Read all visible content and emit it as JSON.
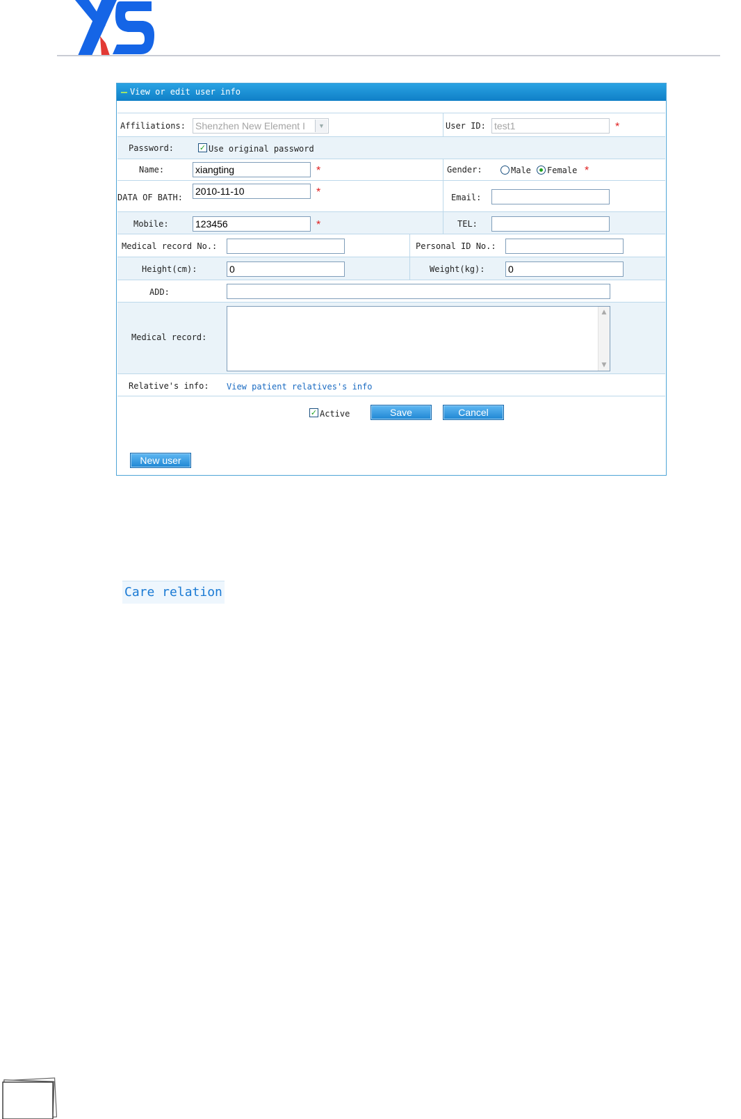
{
  "header": {
    "logo_text": "XS",
    "corner_mark": "'"
  },
  "panel": {
    "title": "View or edit user info"
  },
  "form": {
    "affiliations": {
      "label": "Affiliations:",
      "value": "Shenzhen New Element I"
    },
    "user_id": {
      "label": "User ID:",
      "value": "test1"
    },
    "password": {
      "label": "Password:",
      "option_label": "Use original password",
      "checked": true
    },
    "name": {
      "label": "Name:",
      "value": "xiangting"
    },
    "gender": {
      "label": "Gender:",
      "options": [
        "Male",
        "Female"
      ],
      "selected": "Female"
    },
    "dob": {
      "label": "DATA OF BATH:",
      "value": "2010-11-10"
    },
    "email": {
      "label": "Email:",
      "value": ""
    },
    "mobile": {
      "label": "Mobile:",
      "value": "123456"
    },
    "tel": {
      "label": "TEL:",
      "value": ""
    },
    "medical_record_no": {
      "label": "Medical record No.:",
      "value": ""
    },
    "personal_id_no": {
      "label": "Personal ID No.:",
      "value": ""
    },
    "height": {
      "label": "Height(cm):",
      "value": "0"
    },
    "weight": {
      "label": "Weight(kg):",
      "value": "0"
    },
    "address": {
      "label": "ADD:",
      "value": ""
    },
    "medical_record": {
      "label": "Medical record:",
      "value": ""
    },
    "relatives": {
      "label": "Relative's info:",
      "link": "View patient relatives's info"
    },
    "required_mark": "*"
  },
  "actions": {
    "active_label": "Active",
    "active_checked": true,
    "save": "Save",
    "cancel": "Cancel",
    "new_user": "New user"
  },
  "care_relation": {
    "label": "Care relation"
  },
  "colors": {
    "panel_header": "#1a8fd6",
    "link": "#1a6bc2",
    "required": "#e02020",
    "row_alt": "#eaf3f9",
    "logo_blue": "#1565e6",
    "logo_red": "#e23a35"
  }
}
